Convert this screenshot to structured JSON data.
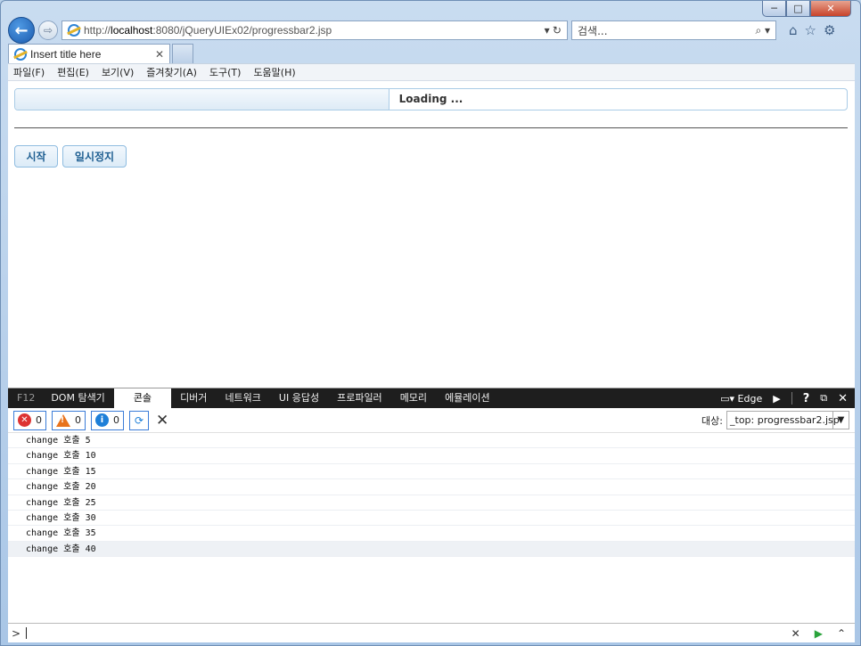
{
  "window": {
    "minimize_label": "─",
    "maximize_label": "□",
    "close_label": "✕"
  },
  "nav": {
    "url_scheme": "http://",
    "url_host": "localhost",
    "url_rest": ":8080/jQueryUIEx02/progressbar2.jsp",
    "address_tools": "▾ ↻",
    "search_placeholder": "검색...",
    "search_tools": "⌕ ▾"
  },
  "tab": {
    "title": "Insert title here",
    "close": "✕"
  },
  "menu": [
    "파일(F)",
    "편집(E)",
    "보기(V)",
    "즐겨찾기(A)",
    "도구(T)",
    "도움말(H)"
  ],
  "progress": {
    "value_percent": 45,
    "label": "Loading ..."
  },
  "buttons": {
    "start": "시작",
    "pause": "일시정지"
  },
  "devtools": {
    "f12": "F12",
    "tabs": [
      "DOM 탐색기",
      "콘솔",
      "디버거",
      "네트워크",
      "UI 응답성",
      "프로파일러",
      "메모리",
      "에뮬레이션"
    ],
    "active_tab": "콘솔",
    "mode": "Edge",
    "help": "?",
    "close": "✕",
    "errors": "0",
    "warnings": "0",
    "infos": "0",
    "target_label": "대상:",
    "target_value": "_top: progressbar2.jsp",
    "log": [
      {
        "prefix": "change ",
        "ko": "호출",
        "num": " 5"
      },
      {
        "prefix": "change ",
        "ko": "호출",
        "num": " 10"
      },
      {
        "prefix": "change ",
        "ko": "호출",
        "num": " 15"
      },
      {
        "prefix": "change ",
        "ko": "호출",
        "num": " 20"
      },
      {
        "prefix": "change ",
        "ko": "호출",
        "num": " 25"
      },
      {
        "prefix": "change ",
        "ko": "호출",
        "num": " 30"
      },
      {
        "prefix": "change ",
        "ko": "호출",
        "num": " 35"
      },
      {
        "prefix": "change ",
        "ko": "호출",
        "num": " 40"
      }
    ],
    "prompt": ">"
  }
}
